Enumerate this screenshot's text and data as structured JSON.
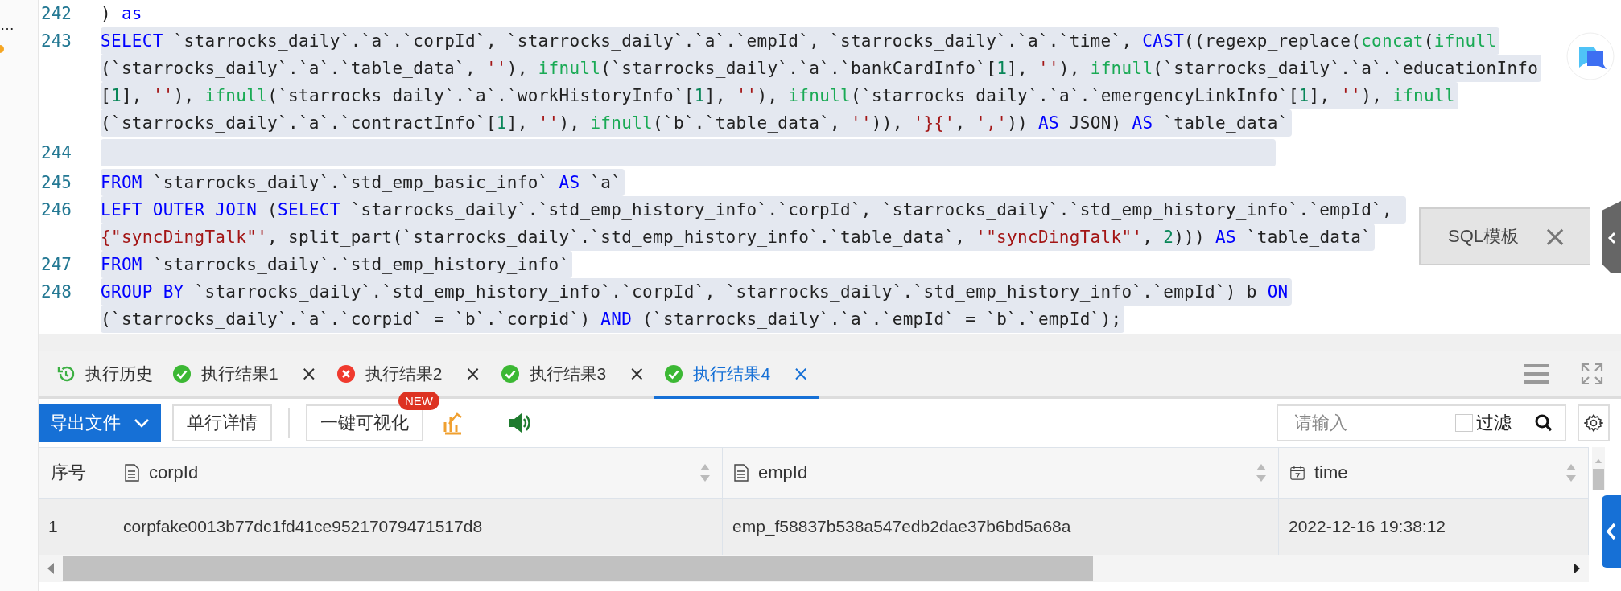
{
  "side_panel": {
    "ellipsis": "…"
  },
  "editor": {
    "lines": [
      {
        "number": "242",
        "selected": false,
        "rows": [
          {
            "tokens": [
              {
                "kind": "plain",
                "text": ") "
              },
              {
                "kind": "keyword",
                "text": "as"
              }
            ]
          }
        ]
      },
      {
        "number": "243",
        "selected": true,
        "rows": [
          {
            "tokens": [
              {
                "kind": "keyword",
                "text": "SELECT"
              },
              {
                "kind": "plain",
                "text": " `starrocks_daily`.`a`.`corpId`, `starrocks_daily`.`a`.`empId`, `starrocks_daily`.`a`.`time`, "
              },
              {
                "kind": "keyword",
                "text": "CAST"
              },
              {
                "kind": "plain",
                "text": "((regexp_replace("
              },
              {
                "kind": "function",
                "text": "concat"
              },
              {
                "kind": "plain",
                "text": "("
              },
              {
                "kind": "function",
                "text": "ifnull"
              }
            ]
          },
          {
            "tokens": [
              {
                "kind": "plain",
                "text": "(`starrocks_daily`.`a`.`table_data`, "
              },
              {
                "kind": "string",
                "text": "''"
              },
              {
                "kind": "plain",
                "text": "), "
              },
              {
                "kind": "function",
                "text": "ifnull"
              },
              {
                "kind": "plain",
                "text": "(`starrocks_daily`.`a`.`bankCardInfo`["
              },
              {
                "kind": "number",
                "text": "1"
              },
              {
                "kind": "plain",
                "text": "], "
              },
              {
                "kind": "string",
                "text": "''"
              },
              {
                "kind": "plain",
                "text": "), "
              },
              {
                "kind": "function",
                "text": "ifnull"
              },
              {
                "kind": "plain",
                "text": "(`starrocks_daily`.`a`.`educationInfo"
              }
            ]
          },
          {
            "tokens": [
              {
                "kind": "plain",
                "text": "["
              },
              {
                "kind": "number",
                "text": "1"
              },
              {
                "kind": "plain",
                "text": "], "
              },
              {
                "kind": "string",
                "text": "''"
              },
              {
                "kind": "plain",
                "text": "), "
              },
              {
                "kind": "function",
                "text": "ifnull"
              },
              {
                "kind": "plain",
                "text": "(`starrocks_daily`.`a`.`workHistoryInfo`["
              },
              {
                "kind": "number",
                "text": "1"
              },
              {
                "kind": "plain",
                "text": "], "
              },
              {
                "kind": "string",
                "text": "''"
              },
              {
                "kind": "plain",
                "text": "), "
              },
              {
                "kind": "function",
                "text": "ifnull"
              },
              {
                "kind": "plain",
                "text": "(`starrocks_daily`.`a`.`emergencyLinkInfo`["
              },
              {
                "kind": "number",
                "text": "1"
              },
              {
                "kind": "plain",
                "text": "], "
              },
              {
                "kind": "string",
                "text": "''"
              },
              {
                "kind": "plain",
                "text": "), "
              },
              {
                "kind": "function",
                "text": "ifnull"
              }
            ]
          },
          {
            "tokens": [
              {
                "kind": "plain",
                "text": "(`starrocks_daily`.`a`.`contractInfo`["
              },
              {
                "kind": "number",
                "text": "1"
              },
              {
                "kind": "plain",
                "text": "], "
              },
              {
                "kind": "string",
                "text": "''"
              },
              {
                "kind": "plain",
                "text": "), "
              },
              {
                "kind": "function",
                "text": "ifnull"
              },
              {
                "kind": "plain",
                "text": "(`b`.`table_data`, "
              },
              {
                "kind": "string",
                "text": "''"
              },
              {
                "kind": "plain",
                "text": ")), "
              },
              {
                "kind": "string",
                "text": "'}{'"
              },
              {
                "kind": "plain",
                "text": ", "
              },
              {
                "kind": "string",
                "text": "','"
              },
              {
                "kind": "plain",
                "text": ")) "
              },
              {
                "kind": "keyword",
                "text": "AS"
              },
              {
                "kind": "plain",
                "text": " JSON) "
              },
              {
                "kind": "keyword",
                "text": "AS"
              },
              {
                "kind": "plain",
                "text": " `table_data`"
              }
            ]
          }
        ]
      },
      {
        "number": "244",
        "selected": true,
        "rows": [
          {}
        ]
      },
      {
        "number": "245",
        "selected": true,
        "rows": [
          {
            "tokens": [
              {
                "kind": "keyword",
                "text": "FROM"
              },
              {
                "kind": "plain",
                "text": " `starrocks_daily`.`std_emp_basic_info` "
              },
              {
                "kind": "keyword",
                "text": "AS"
              },
              {
                "kind": "plain",
                "text": " `a`"
              }
            ]
          }
        ]
      },
      {
        "number": "246",
        "selected": true,
        "rows": [
          {
            "tokens": [
              {
                "kind": "keyword",
                "text": "LEFT OUTER JOIN"
              },
              {
                "kind": "plain",
                "text": " ("
              },
              {
                "kind": "keyword",
                "text": "SELECT"
              },
              {
                "kind": "plain",
                "text": " `starrocks_daily`.`std_emp_history_info`.`corpId`, `starrocks_daily`.`std_emp_history_info`.`empId`, "
              }
            ]
          },
          {
            "tokens": [
              {
                "kind": "string",
                "text": "{\"syncDingTalk\"'"
              },
              {
                "kind": "plain",
                "text": ", split_part(`starrocks_daily`.`std_emp_history_info`.`table_data`, "
              },
              {
                "kind": "string",
                "text": "'\"syncDingTalk\"'"
              },
              {
                "kind": "plain",
                "text": ", "
              },
              {
                "kind": "number",
                "text": "2"
              },
              {
                "kind": "plain",
                "text": "))) "
              },
              {
                "kind": "keyword",
                "text": "AS"
              },
              {
                "kind": "plain",
                "text": " `table_data`"
              }
            ]
          }
        ]
      },
      {
        "number": "247",
        "selected": true,
        "rows": [
          {
            "tokens": [
              {
                "kind": "keyword",
                "text": "FROM"
              },
              {
                "kind": "plain",
                "text": " `starrocks_daily`.`std_emp_history_info`"
              }
            ]
          }
        ]
      },
      {
        "number": "248",
        "selected": true,
        "rows": [
          {
            "tokens": [
              {
                "kind": "keyword",
                "text": "GROUP BY"
              },
              {
                "kind": "plain",
                "text": " `starrocks_daily`.`std_emp_history_info`.`corpId`, `starrocks_daily`.`std_emp_history_info`.`empId`) b "
              },
              {
                "kind": "keyword",
                "text": "ON"
              }
            ]
          },
          {
            "tokens": [
              {
                "kind": "plain",
                "text": "(`starrocks_daily`.`a`.`corpid` = `b`.`corpid`) "
              },
              {
                "kind": "keyword",
                "text": "AND"
              },
              {
                "kind": "plain",
                "text": " (`starrocks_daily`.`a`.`empId` = `b`.`empId`);"
              }
            ]
          }
        ]
      }
    ]
  },
  "tooltip": {
    "label": "SQL模板",
    "close": "×"
  },
  "tabs": [
    {
      "kind": "history",
      "label": "执行历史",
      "selected": false
    },
    {
      "kind": "success",
      "label": "执行结果1",
      "close": "×",
      "selected": false
    },
    {
      "kind": "error",
      "label": "执行结果2",
      "close": "×",
      "selected": false
    },
    {
      "kind": "success",
      "label": "执行结果3",
      "close": "×",
      "selected": false
    },
    {
      "kind": "success",
      "label": "执行结果4",
      "close": "×",
      "selected": true
    }
  ],
  "toolbar": {
    "export": "导出文件",
    "row_detail": "单行详情",
    "visualize": "一键可视化",
    "badge": "NEW",
    "search": {
      "placeholder": "请输入"
    },
    "filter": {
      "label": "过滤",
      "checked": false
    }
  },
  "table": {
    "columns": [
      {
        "label": "序号",
        "kind": "index"
      },
      {
        "label": "corpId",
        "kind": "text"
      },
      {
        "label": "empId",
        "kind": "text"
      },
      {
        "label": "time",
        "kind": "date"
      }
    ],
    "rows": [
      [
        "1",
        "corpfake0013b77dc1fd41ce95217079471517d8",
        "emp_f58837b538a547edb2dae37b6bd5a68a",
        "2022-12-16 19:38:12"
      ]
    ]
  }
}
